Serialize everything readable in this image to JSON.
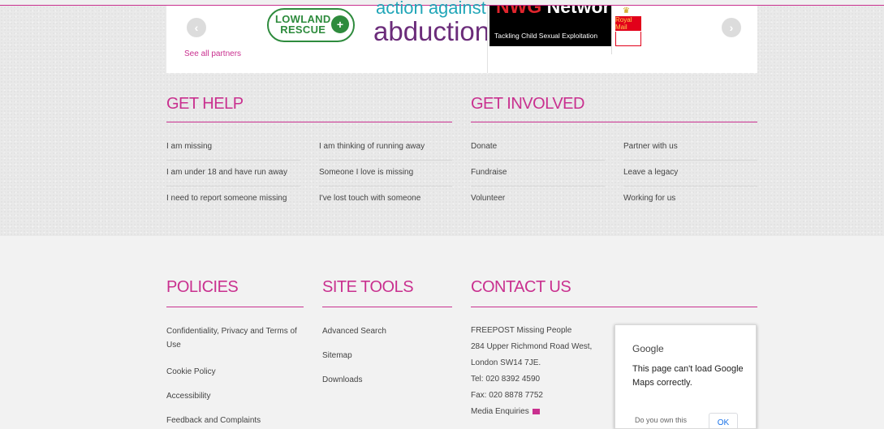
{
  "partners": {
    "prev_arrow": "‹",
    "next_arrow": "›",
    "see_all": "See all partners",
    "logos": {
      "lowland_line1": "LOWLAND",
      "lowland_line2": "RESCUE",
      "lowland_badge": "+",
      "aaa_line1": "action against",
      "aaa_line2": "abduction",
      "nwg_prefix": "NWG",
      "nwg_word": "Network",
      "nwg_tagline": "Tackling Child Sexual Exploitation",
      "royal_mail": "Royal Mail"
    }
  },
  "get_help": {
    "title": "GET HELP",
    "col1": [
      "I am missing",
      "I am under 18 and have run away",
      "I need to report someone missing"
    ],
    "col2": [
      "I am thinking of running away",
      "Someone I love is missing",
      "I've lost touch with someone"
    ]
  },
  "get_involved": {
    "title": "GET INVOLVED",
    "col1": [
      "Donate",
      "Fundraise",
      "Volunteer"
    ],
    "col2": [
      "Partner with us",
      "Leave a legacy",
      "Working for us"
    ]
  },
  "policies": {
    "title": "POLICIES",
    "links": [
      "Confidentiality, Privacy and Terms of Use",
      "Cookie Policy",
      "Accessibility",
      "Feedback and Complaints"
    ]
  },
  "site_tools": {
    "title": "SITE TOOLS",
    "links": [
      "Advanced Search",
      "Sitemap",
      "Downloads"
    ]
  },
  "contact": {
    "title": "CONTACT US",
    "lines": [
      "FREEPOST Missing People",
      "284 Upper Richmond Road West,",
      "London SW14 7JE.",
      "Tel: 020 8392 4590",
      "Fax: 020 8878 7752"
    ],
    "media": "Media Enquiries"
  },
  "map": {
    "brand": "Google",
    "message": "This page can't load Google Maps correctly.",
    "question": "Do you own this",
    "ok": "OK"
  },
  "colors": {
    "accent": "#c9308f",
    "text": "#444444"
  }
}
